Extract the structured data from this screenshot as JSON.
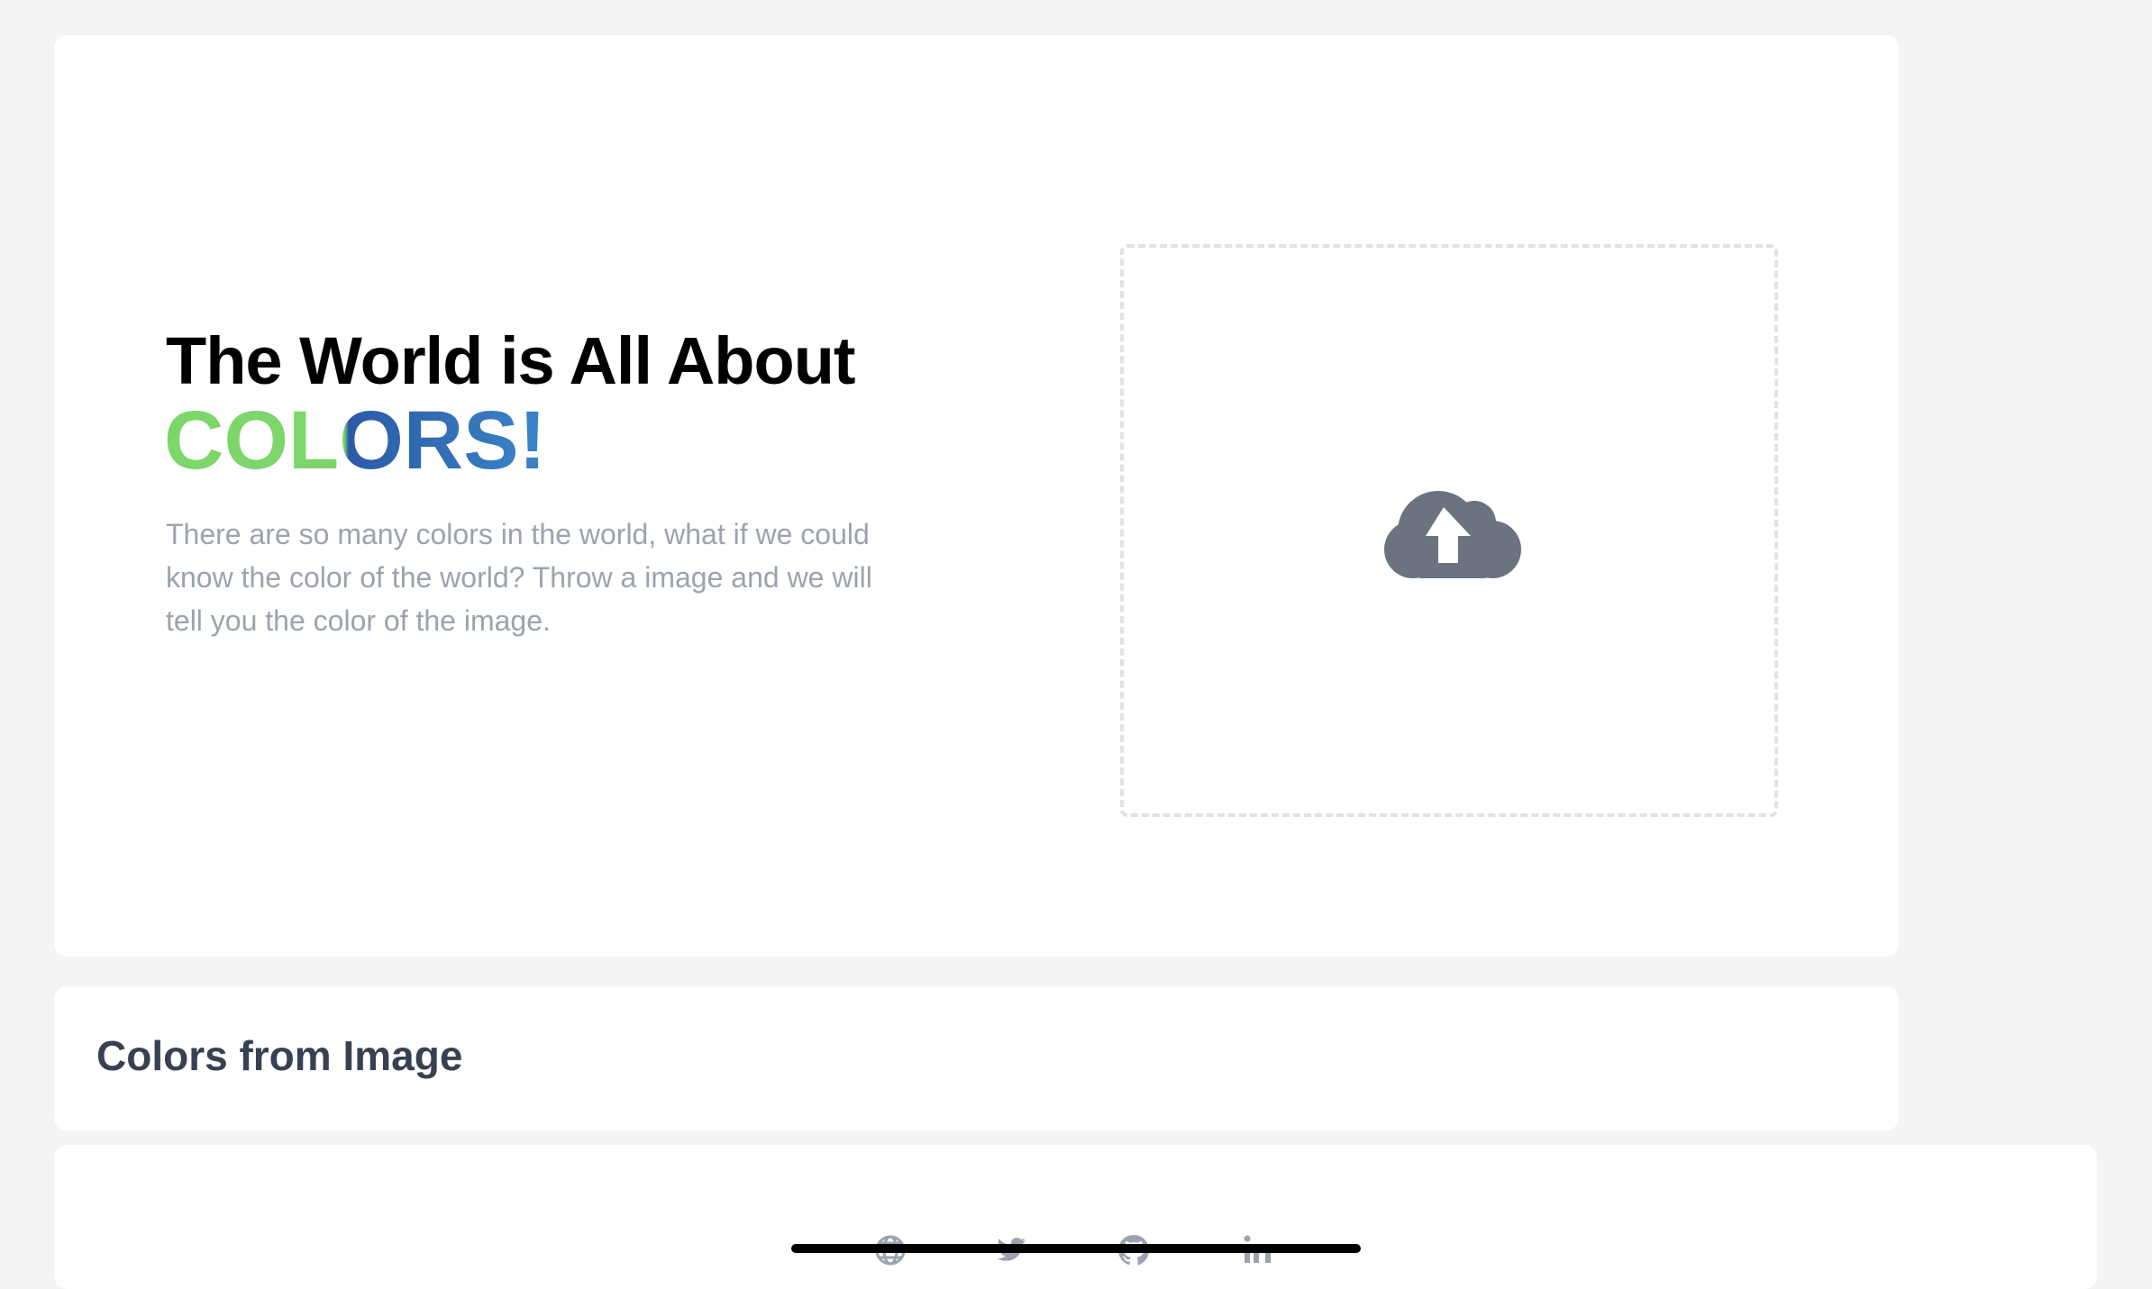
{
  "hero": {
    "title": "The World is All About",
    "accent": "COLORS!",
    "description": "There are so many colors in the world, what if we could know the color of the world? Throw a image and we will tell you the color of the image."
  },
  "dropzone": {
    "icon": "cloud-upload-icon"
  },
  "colors_section": {
    "title": "Colors from Image"
  },
  "footer": {
    "social_links": [
      {
        "name": "website",
        "icon": "globe-icon"
      },
      {
        "name": "twitter",
        "icon": "twitter-icon"
      },
      {
        "name": "github",
        "icon": "github-icon"
      },
      {
        "name": "linkedin",
        "icon": "linkedin-icon"
      }
    ]
  },
  "colors": {
    "background": "#f3f4f6",
    "card": "#ffffff",
    "accent_green": "#7cd66a",
    "accent_blue": "#2c5aa6",
    "muted_text": "#9ca3af",
    "icon_gray": "#6b7280"
  }
}
